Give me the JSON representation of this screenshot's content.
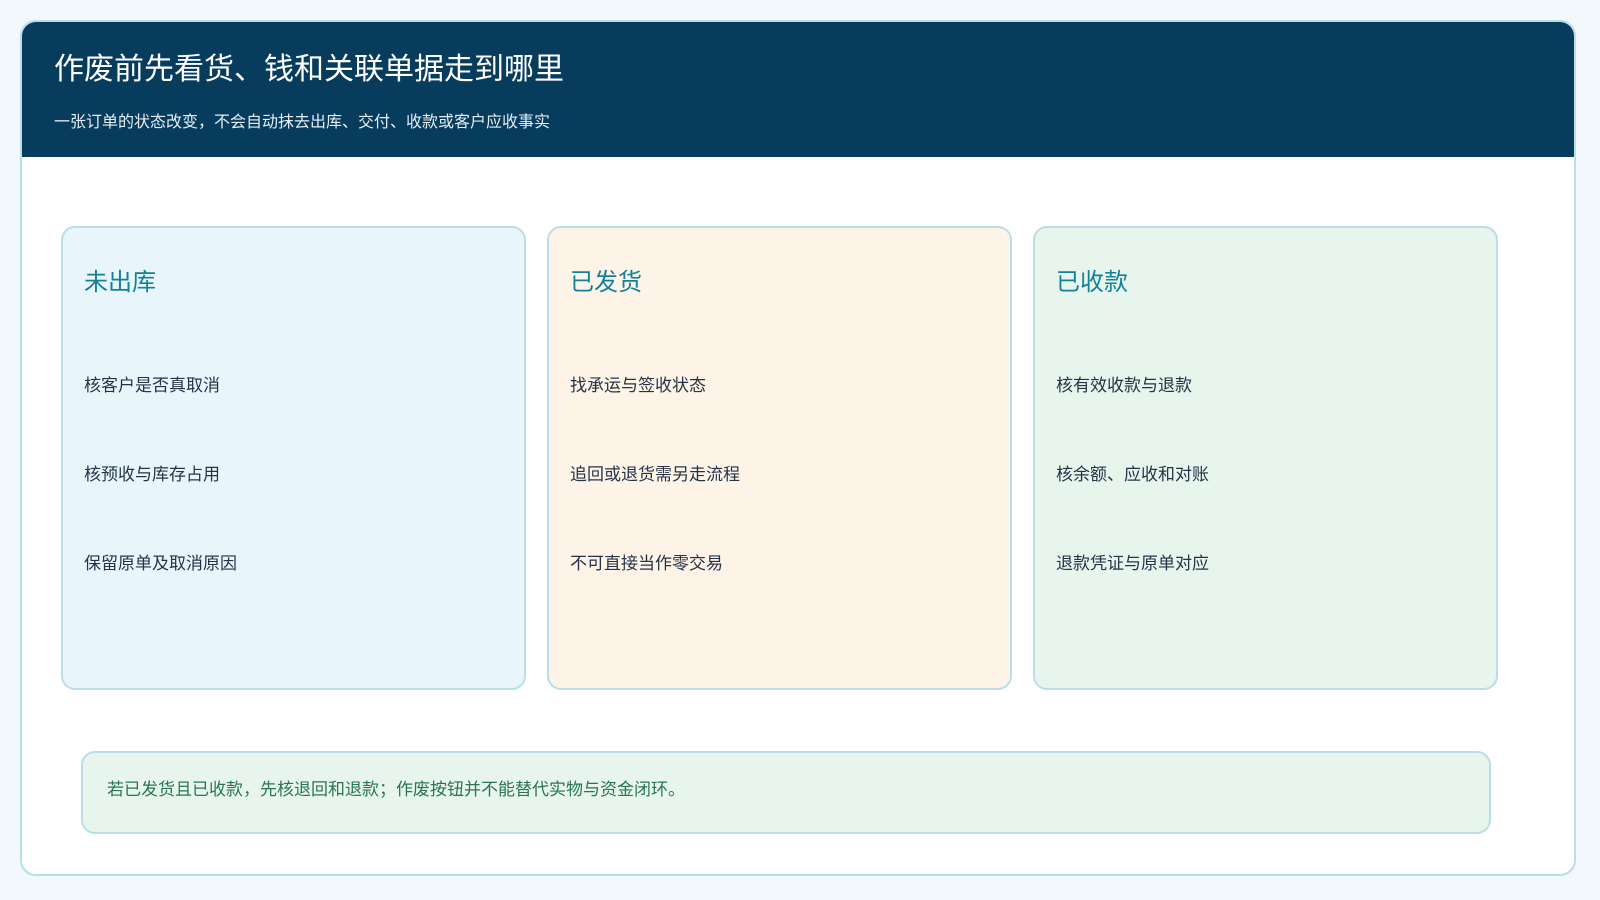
{
  "header": {
    "title": "作废前先看货、钱和关联单据走到哪里",
    "subtitle": "一张订单的状态改变，不会自动抹去出库、交付、收款或客户应收事实"
  },
  "cards": [
    {
      "title": "未出库",
      "bg": "#e8f6fb",
      "items": [
        "核客户是否真取消",
        "核预收与库存占用",
        "保留原单及取消原因"
      ]
    },
    {
      "title": "已发货",
      "bg": "#fdf3e7",
      "items": [
        "找承运与签收状态",
        "追回或退货需另走流程",
        "不可直接当作零交易"
      ]
    },
    {
      "title": "已收款",
      "bg": "#e7f5ec",
      "items": [
        "核有效收款与退款",
        "核余额、应收和对账",
        "退款凭证与原单对应"
      ]
    }
  ],
  "note": {
    "text": "若已发货且已收款，先核退回和退款；作废按钮并不能替代实物与资金闭环。"
  },
  "colors": {
    "header_bg": "#073c5c",
    "accent": "#14819a",
    "border": "#b9deea",
    "note_text": "#2a7550"
  }
}
